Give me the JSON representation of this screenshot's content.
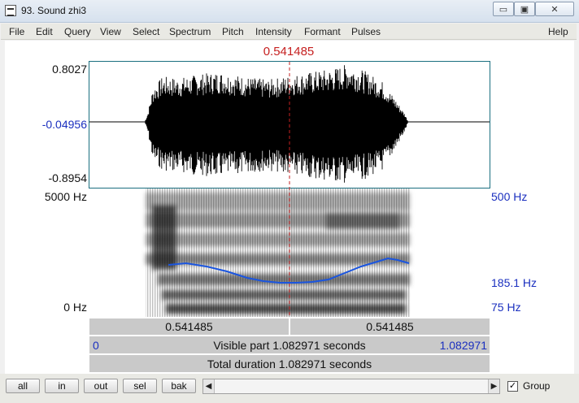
{
  "window": {
    "title": "93. Sound zhi3",
    "minimize": "▭",
    "maximize": "▣",
    "close": "✕"
  },
  "menu": [
    "File",
    "Edit",
    "Query",
    "View",
    "Select",
    "Spectrum",
    "Pitch",
    "Intensity",
    "Formant",
    "Pulses",
    "Help"
  ],
  "cursor": {
    "time": "0.541485"
  },
  "waveform": {
    "max": "0.8027",
    "zero": "-0.04956",
    "min": "-0.8954"
  },
  "spectrogram": {
    "freq_top": "5000 Hz",
    "freq_bottom": "0 Hz",
    "pitch_top": "500 Hz",
    "pitch_current": "185.1 Hz",
    "pitch_bottom": "75 Hz"
  },
  "time_bar": {
    "left": "0.541485",
    "right": "0.541485"
  },
  "visible_bar": {
    "start": "0",
    "text": "Visible part 1.082971 seconds",
    "end": "1.082971"
  },
  "total_bar": {
    "text": "Total duration 1.082971 seconds"
  },
  "toolbar": {
    "all": "all",
    "in": "in",
    "out": "out",
    "sel": "sel",
    "bak": "bak",
    "group_label": "Group",
    "group_checked": "✓",
    "scroll_left": "◀",
    "scroll_right": "▶"
  },
  "colors": {
    "cursor": "#c62020",
    "pitch": "#1a55e0",
    "label_blue": "#1a2fbf",
    "frame": "#1b6f80"
  }
}
